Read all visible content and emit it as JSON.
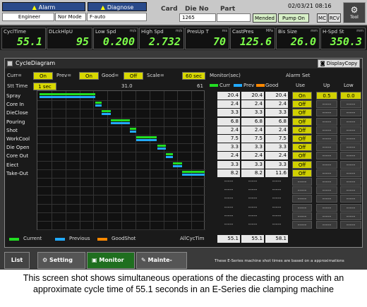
{
  "header": {
    "alarm_label": "Alarm",
    "diagnose_label": "Diagnose",
    "user": "Engineer",
    "mode": "Nor Mode",
    "auto": "F-auto",
    "card_label": "Card",
    "die_no_label": "Die No",
    "part_label": "Part",
    "die_no_value": "1265",
    "datetime": "02/03/21 08:16",
    "mended_label": "Mended",
    "pump_label": "Pump On",
    "mc_label": "MC",
    "rcv_label": "RCV",
    "tool_label": "Tool"
  },
  "metrics": [
    {
      "name": "CyclTime",
      "unit": "",
      "value": "55.1"
    },
    {
      "name": "DLckHlpU",
      "unit": "",
      "value": "95"
    },
    {
      "name": "Low Spd",
      "unit": "m/s",
      "value": "0.200"
    },
    {
      "name": "High Spd",
      "unit": "m/s",
      "value": "2.732"
    },
    {
      "name": "PresUp T",
      "unit": "ms",
      "value": "70"
    },
    {
      "name": "CastPres",
      "unit": "MPa",
      "value": "125.6"
    },
    {
      "name": "Bis Size",
      "unit": "mm",
      "value": "26.0"
    },
    {
      "name": "H-Spd St",
      "unit": "mm",
      "value": "350.3"
    }
  ],
  "diagram": {
    "title": "CycleDiagram",
    "display_copy_label": "DisplayCopy",
    "curr_label": "Curr=",
    "curr_value": "On",
    "prev_label": "Prev=",
    "prev_value": "On",
    "good_label": "Good=",
    "good_value": "Off",
    "scale_label": "Scale=",
    "scale_value": "60 sec",
    "stt_time_label": "Stt Time",
    "stt_time_value": "1 sec",
    "axis_mid": "31.0",
    "axis_end": "61",
    "monitor_label": "Monitor(sec)",
    "alarm_set_label": "Alarm Set",
    "col_curr": "Curr",
    "col_prev": "Prev",
    "col_good": "Good",
    "col_use": "Use",
    "col_up": "Up",
    "col_low": "Low",
    "rows": [
      {
        "name": "Spray",
        "curr": "20.4",
        "prev": "20.4",
        "good": "20.4",
        "use": "On",
        "up": "0.5",
        "low": "0.0",
        "start": 1,
        "dur": 20.4
      },
      {
        "name": "Core In",
        "curr": "2.4",
        "prev": "2.4",
        "good": "2.4",
        "use": "Off",
        "up": "-----",
        "low": "-----",
        "start": 21.3,
        "dur": 2.4
      },
      {
        "name": "DieClose",
        "curr": "3.3",
        "prev": "3.3",
        "good": "3.3",
        "use": "Off",
        "up": "-----",
        "low": "-----",
        "start": 23.7,
        "dur": 3.3
      },
      {
        "name": "Pouring",
        "curr": "6.8",
        "prev": "6.8",
        "good": "6.8",
        "use": "Off",
        "up": "-----",
        "low": "-----",
        "start": 27.0,
        "dur": 6.8
      },
      {
        "name": "Shot",
        "curr": "2.4",
        "prev": "2.4",
        "good": "2.4",
        "use": "Off",
        "up": "-----",
        "low": "-----",
        "start": 33.8,
        "dur": 2.4
      },
      {
        "name": "WorkCool",
        "curr": "7.5",
        "prev": "7.5",
        "good": "7.5",
        "use": "Off",
        "up": "-----",
        "low": "-----",
        "start": 36.2,
        "dur": 7.5
      },
      {
        "name": "Die Open",
        "curr": "3.3",
        "prev": "3.3",
        "good": "3.3",
        "use": "Off",
        "up": "-----",
        "low": "-----",
        "start": 43.7,
        "dur": 3.3
      },
      {
        "name": "Core Out",
        "curr": "2.4",
        "prev": "2.4",
        "good": "2.4",
        "use": "Off",
        "up": "-----",
        "low": "-----",
        "start": 47.0,
        "dur": 2.4
      },
      {
        "name": "Eiect",
        "curr": "3.3",
        "prev": "3.3",
        "good": "3.3",
        "use": "Off",
        "up": "-----",
        "low": "-----",
        "start": 49.4,
        "dur": 3.3
      },
      {
        "name": "Take-Out",
        "curr": "8.2",
        "prev": "8.2",
        "good": "11.6",
        "use": "Off",
        "up": "-----",
        "low": "-----",
        "start": 52.7,
        "dur": 8.2
      }
    ],
    "empty_rows": 6,
    "empty_value": "-----",
    "legend_current": "Current",
    "legend_previous": "Previous",
    "legend_good": "GoodShot",
    "allcyc_label": "AllCycTim",
    "allcyc_curr": "55.1",
    "allcyc_prev": "55.1",
    "allcyc_good": "58.1",
    "colors": {
      "current": "#22dd22",
      "previous": "#22aaff",
      "good": "#ff8800"
    }
  },
  "nav": {
    "list_label": "List",
    "setting_label": "Setting",
    "monitor_label": "Monitor",
    "mainte_label": "Mainte-",
    "note": "These E-Series machine shot times are based on a approximations"
  },
  "caption": "This screen shot shows simultaneous operations of the diecasting process with an approximate cycle time of 55.1 seconds in an E-Series die clamping machine"
}
